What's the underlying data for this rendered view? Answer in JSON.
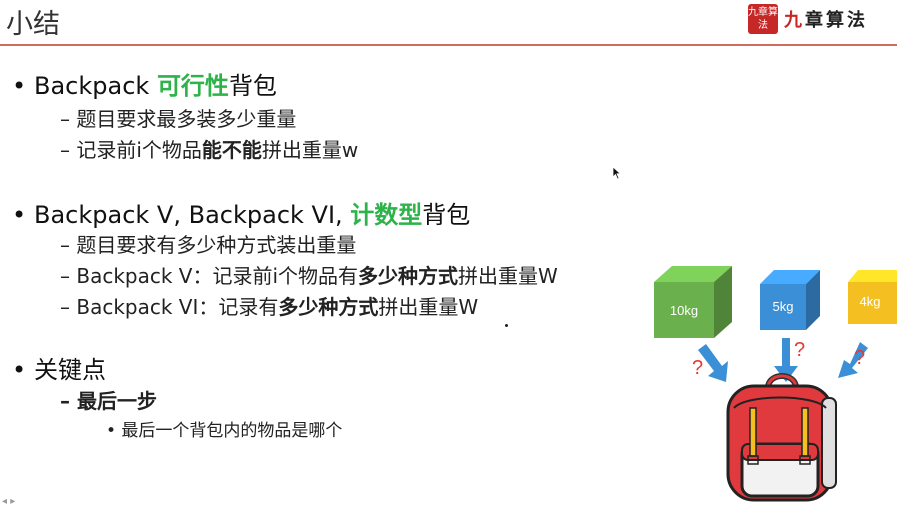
{
  "slide": {
    "title": "小结",
    "logo": {
      "seal_text": "九章算法",
      "brand": "九章算法"
    }
  },
  "sections": [
    {
      "prefix": "Backpack ",
      "highlight": "可行性",
      "suffix": "背包",
      "items": [
        {
          "parts": [
            {
              "text": "– 题目要求最多装多少重量",
              "bold": false
            }
          ]
        },
        {
          "parts": [
            {
              "text": "– 记录前i个物品",
              "bold": false
            },
            {
              "text": "能不能",
              "bold": true
            },
            {
              "text": "拼出重量w",
              "bold": false
            }
          ]
        }
      ]
    },
    {
      "prefix": "Backpack V, Backpack VI, ",
      "highlight": "计数型",
      "suffix": "背包",
      "items": [
        {
          "parts": [
            {
              "text": "– 题目要求有多少种方式装出重量",
              "bold": false
            }
          ]
        },
        {
          "parts": [
            {
              "text": "– Backpack V：记录前i个物品有",
              "bold": false
            },
            {
              "text": "多少种方式",
              "bold": true
            },
            {
              "text": "拼出重量W",
              "bold": false
            }
          ]
        },
        {
          "parts": [
            {
              "text": "– Backpack VI：记录有",
              "bold": false
            },
            {
              "text": "多少种方式",
              "bold": true
            },
            {
              "text": "拼出重量W",
              "bold": false
            }
          ]
        }
      ]
    },
    {
      "heading": "关键点",
      "sub": "– 最后一步",
      "detail": "• 最后一个背包内的物品是哪个"
    }
  ],
  "illustration": {
    "boxes": [
      {
        "label": "10kg",
        "color": "#6ab04c"
      },
      {
        "label": "5kg",
        "color": "#3b8fd6"
      },
      {
        "label": "4kg",
        "color": "#f4c021"
      }
    ],
    "question_mark": "?",
    "bag_color": "#e03a3e"
  }
}
